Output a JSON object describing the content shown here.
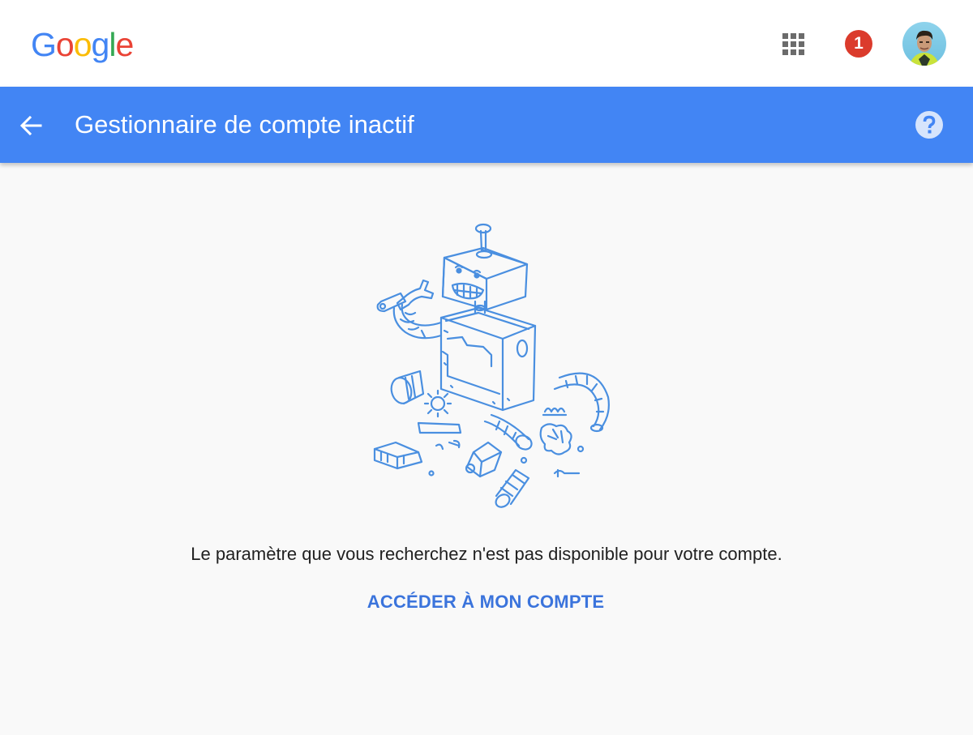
{
  "brand": {
    "logo_letters": [
      {
        "char": "G",
        "color": "#4285f4"
      },
      {
        "char": "o",
        "color": "#ea4335"
      },
      {
        "char": "o",
        "color": "#fbbc05"
      },
      {
        "char": "g",
        "color": "#4285f4"
      },
      {
        "char": "l",
        "color": "#34a853"
      },
      {
        "char": "e",
        "color": "#ea4335"
      }
    ]
  },
  "topbar": {
    "apps_icon": "apps-grid-icon",
    "notification_count": "1",
    "notification_color": "#db3b2c",
    "avatar_icon": "user-avatar"
  },
  "header": {
    "title": "Gestionnaire de compte inactif",
    "back_icon": "arrow-left-icon",
    "help_icon": "help-circle-icon",
    "background": "#4285f4"
  },
  "main": {
    "illustration": "broken-robot-illustration",
    "message": "Le paramètre que vous recherchez n'est pas disponible pour votre compte.",
    "link_label": "ACCÉDER À MON COMPTE",
    "link_color": "#3b74dc"
  }
}
